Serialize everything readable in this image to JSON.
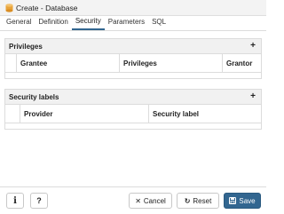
{
  "window": {
    "title": "Create - Database",
    "icon": "database-icon"
  },
  "tabs": [
    {
      "label": "General"
    },
    {
      "label": "Definition"
    },
    {
      "label": "Security"
    },
    {
      "label": "Parameters"
    },
    {
      "label": "SQL"
    }
  ],
  "active_tab": "Security",
  "privileges": {
    "title": "Privileges",
    "add_icon": "plus-icon",
    "columns": [
      "Grantee",
      "Privileges",
      "Grantor"
    ]
  },
  "security_labels": {
    "title": "Security labels",
    "add_icon": "plus-icon",
    "columns": [
      "Provider",
      "Security label"
    ]
  },
  "footer": {
    "info_icon": "info-icon",
    "help_label": "?",
    "cancel_label": "Cancel",
    "reset_label": "Reset",
    "save_label": "Save"
  },
  "colors": {
    "accent": "#326690",
    "header_bg": "#f1f1f1",
    "border": "#dcdcdc"
  }
}
